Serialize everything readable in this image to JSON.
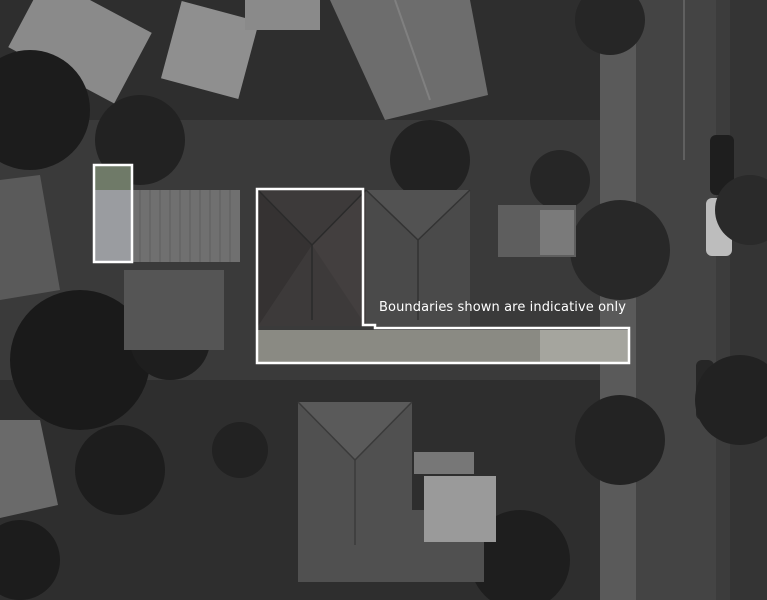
{
  "map": {
    "view": "aerial-photo",
    "tone": "grayscale",
    "annotation_text": "Boundaries shown are indicative only",
    "boundary_color": "#ffffff"
  }
}
